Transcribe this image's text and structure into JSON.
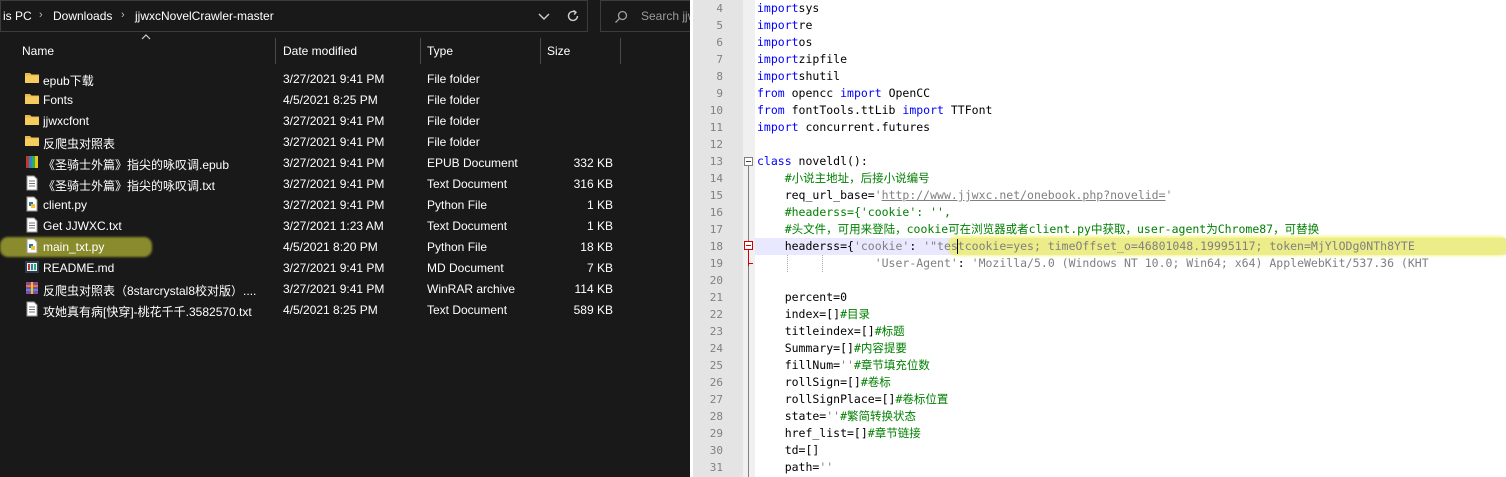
{
  "explorer": {
    "breadcrumb": [
      "is PC",
      "Downloads",
      "jjwxcNovelCrawler-master"
    ],
    "search_placeholder": "Search jjwx",
    "columns": {
      "name": "Name",
      "date": "Date modified",
      "type": "Type",
      "size": "Size"
    },
    "files": [
      {
        "name": "epub下载",
        "date": "3/27/2021 9:41 PM",
        "type": "File folder",
        "size": "",
        "icon": "folder-icon"
      },
      {
        "name": "Fonts",
        "date": "4/5/2021 8:25 PM",
        "type": "File folder",
        "size": "",
        "icon": "folder-icon"
      },
      {
        "name": "jjwxcfont",
        "date": "3/27/2021 9:41 PM",
        "type": "File folder",
        "size": "",
        "icon": "folder-icon"
      },
      {
        "name": "反爬虫对照表",
        "date": "3/27/2021 9:41 PM",
        "type": "File folder",
        "size": "",
        "icon": "folder-icon"
      },
      {
        "name": "《圣骑士外篇》指尖的咏叹调.epub",
        "date": "3/27/2021 9:41 PM",
        "type": "EPUB Document",
        "size": "332 KB",
        "icon": "epub-icon"
      },
      {
        "name": "《圣骑士外篇》指尖的咏叹调.txt",
        "date": "3/27/2021 9:41 PM",
        "type": "Text Document",
        "size": "316 KB",
        "icon": "text-file-icon"
      },
      {
        "name": "client.py",
        "date": "3/27/2021 9:41 PM",
        "type": "Python File",
        "size": "1 KB",
        "icon": "python-file-icon"
      },
      {
        "name": "Get JJWXC.txt",
        "date": "3/27/2021 1:23 AM",
        "type": "Text Document",
        "size": "1 KB",
        "icon": "text-file-icon"
      },
      {
        "name": "main_txt.py",
        "date": "4/5/2021 8:20 PM",
        "type": "Python File",
        "size": "18 KB",
        "icon": "python-file-icon"
      },
      {
        "name": "README.md",
        "date": "3/27/2021 9:41 PM",
        "type": "MD Document",
        "size": "7 KB",
        "icon": "markdown-file-icon"
      },
      {
        "name": "反爬虫对照表（8starcrystal8校对版）....",
        "date": "3/27/2021 9:41 PM",
        "type": "WinRAR archive",
        "size": "114 KB",
        "icon": "archive-icon"
      },
      {
        "name": "攻她真有病[快穿]-桃花千千.3582570.txt",
        "date": "4/5/2021 8:25 PM",
        "type": "Text Document",
        "size": "589 KB",
        "icon": "text-file-icon"
      }
    ]
  },
  "editor": {
    "lines": [
      {
        "n": "4",
        "parts": [
          [
            "kw",
            "import"
          ],
          [
            "",
            "sys"
          ]
        ]
      },
      {
        "n": "5",
        "parts": [
          [
            "kw",
            "import"
          ],
          [
            "",
            "re"
          ]
        ]
      },
      {
        "n": "6",
        "parts": [
          [
            "kw",
            "import"
          ],
          [
            "",
            "os"
          ]
        ]
      },
      {
        "n": "7",
        "parts": [
          [
            "kw",
            "import"
          ],
          [
            "",
            "zipfile"
          ]
        ]
      },
      {
        "n": "8",
        "parts": [
          [
            "kw",
            "import"
          ],
          [
            "",
            "shutil"
          ]
        ]
      },
      {
        "n": "9",
        "parts": [
          [
            "kw",
            "from"
          ],
          [
            "",
            " opencc "
          ],
          [
            "kw",
            "import"
          ],
          [
            "",
            " OpenCC"
          ]
        ]
      },
      {
        "n": "10",
        "parts": [
          [
            "kw",
            "from"
          ],
          [
            "",
            " fontTools.ttLib "
          ],
          [
            "kw",
            "import"
          ],
          [
            "",
            " TTFont"
          ]
        ]
      },
      {
        "n": "11",
        "parts": [
          [
            "kw",
            "import"
          ],
          [
            "",
            " concurrent.futures"
          ]
        ]
      },
      {
        "n": "12",
        "parts": []
      },
      {
        "n": "13",
        "parts": [
          [
            "kw",
            "class"
          ],
          [
            "",
            " noveldl():"
          ]
        ]
      },
      {
        "n": "14",
        "parts": [
          [
            "",
            "    "
          ],
          [
            "cm",
            "#小说主地址，后接小说编号"
          ]
        ]
      },
      {
        "n": "15",
        "parts": [
          [
            "",
            "    req_url_base="
          ],
          [
            "str",
            "'"
          ],
          [
            "url",
            "http://www.jjwxc.net/onebook.php?novelid="
          ],
          [
            "str",
            "'"
          ]
        ]
      },
      {
        "n": "16",
        "parts": [
          [
            "",
            "    "
          ],
          [
            "cm",
            "#headerss={'cookie': '',"
          ]
        ]
      },
      {
        "n": "17",
        "parts": [
          [
            "",
            "    "
          ],
          [
            "cm",
            "#头文件，可用来登陆，cookie可在浏览器或者client.py中获取，user-agent为Chrome87，可替换"
          ]
        ]
      },
      {
        "n": "18",
        "parts": [
          [
            "",
            "    headerss={"
          ],
          [
            "str",
            "'cookie'"
          ],
          [
            "",
            ": "
          ],
          [
            "str",
            "'\"testcookie=yes; timeOffset_o=46801048.19995117; token=MjYlODg0NTh8YTE"
          ]
        ]
      },
      {
        "n": "19",
        "parts": [
          [
            "",
            "                 "
          ],
          [
            "str",
            "'User-Agent'"
          ],
          [
            "",
            ": "
          ],
          [
            "str",
            "'Mozilla/5.0 (Windows NT 10.0; Win64; x64) AppleWebKit/537.36 (KHT"
          ]
        ]
      },
      {
        "n": "20",
        "parts": []
      },
      {
        "n": "21",
        "parts": [
          [
            "",
            "    percent="
          ],
          [
            "",
            "0"
          ]
        ]
      },
      {
        "n": "22",
        "parts": [
          [
            "",
            "    index=[]"
          ],
          [
            "cm",
            "#目录"
          ]
        ]
      },
      {
        "n": "23",
        "parts": [
          [
            "",
            "    titleindex=[]"
          ],
          [
            "cm",
            "#标题"
          ]
        ]
      },
      {
        "n": "24",
        "parts": [
          [
            "",
            "    Summary=[]"
          ],
          [
            "cm",
            "#内容提要"
          ]
        ]
      },
      {
        "n": "25",
        "parts": [
          [
            "",
            "    fillNum="
          ],
          [
            "str",
            "''"
          ],
          [
            "cm",
            "#章节填充位数"
          ]
        ]
      },
      {
        "n": "26",
        "parts": [
          [
            "",
            "    rollSign=[]"
          ],
          [
            "cm",
            "#卷标"
          ]
        ]
      },
      {
        "n": "27",
        "parts": [
          [
            "",
            "    rollSignPlace=[]"
          ],
          [
            "cm",
            "#卷标位置"
          ]
        ]
      },
      {
        "n": "28",
        "parts": [
          [
            "",
            "    state="
          ],
          [
            "str",
            "''"
          ],
          [
            "cm",
            "#繁简转换状态"
          ]
        ]
      },
      {
        "n": "29",
        "parts": [
          [
            "",
            "    href_list=[]"
          ],
          [
            "cm",
            "#章节链接"
          ]
        ]
      },
      {
        "n": "30",
        "parts": [
          [
            "",
            "    td=[]"
          ]
        ]
      },
      {
        "n": "31",
        "parts": [
          [
            "",
            "    path="
          ],
          [
            "str",
            "''"
          ]
        ]
      }
    ]
  }
}
